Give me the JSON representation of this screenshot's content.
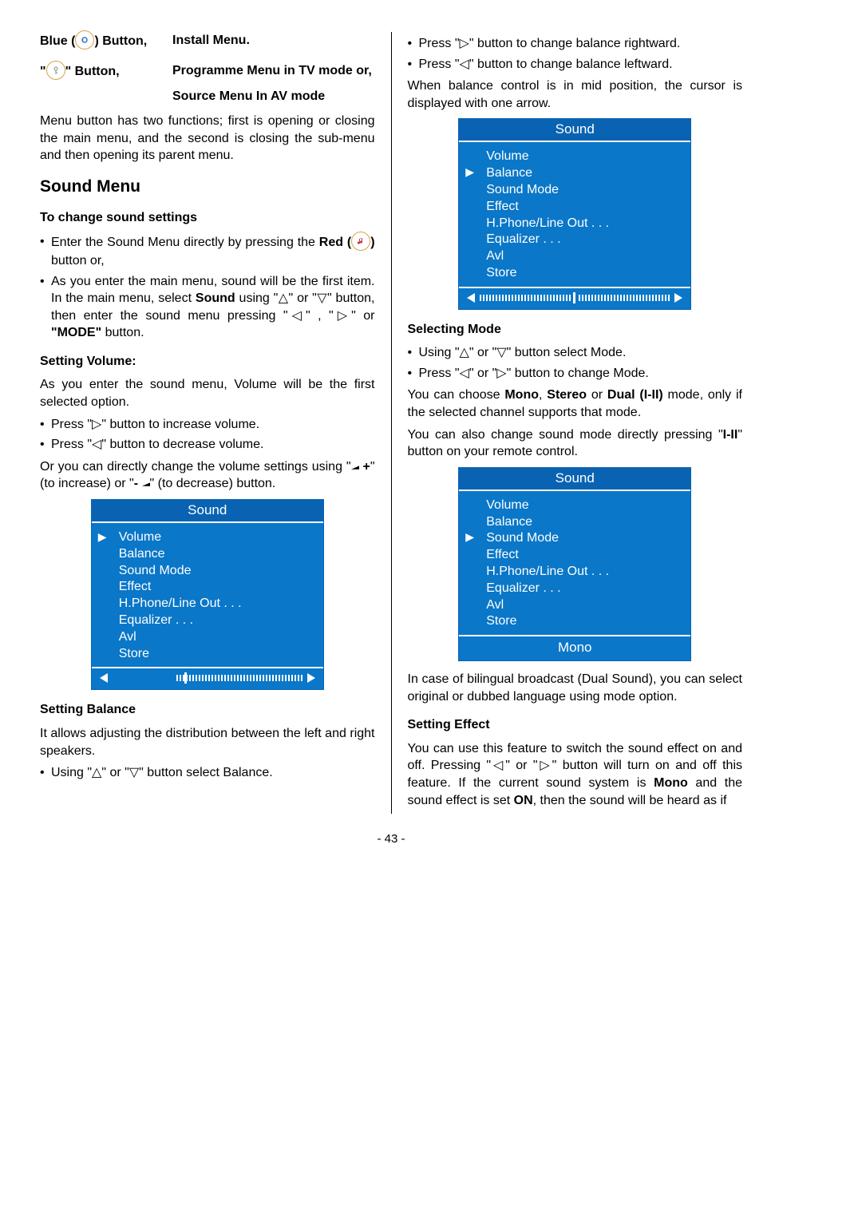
{
  "header": {
    "blue_label_a": "Blue (",
    "blue_label_b": ") Button,",
    "install_menu": "Install Menu.",
    "icon_button_a": "\"",
    "icon_button_b": "\" Button,",
    "programme_menu": "Programme Menu in TV mode or,",
    "source_menu": "Source Menu In AV mode"
  },
  "menu_button_desc": "Menu button has two functions; first is opening or closing the main menu, and the second is closing the sub-menu and then opening its parent menu.",
  "sound_menu_heading": "Sound Menu",
  "to_change_heading": "To change sound settings",
  "enter_sound_menu_a": "Enter the Sound Menu directly by pressing the ",
  "enter_sound_menu_b": "Red (",
  "enter_sound_menu_c": ")",
  "enter_sound_menu_d": " button or,",
  "main_menu_desc_a": "As you enter the main menu, sound will be the first item. In the main menu, select ",
  "main_menu_desc_b": "Sound",
  "main_menu_desc_c": " using \"△\" or \"▽\" button, then enter the sound menu pressing \"◁\" , \"▷\" or ",
  "main_menu_desc_d": "\"MODE\"",
  "main_menu_desc_e": " button.",
  "setting_volume_heading": "Setting Volume:",
  "setting_volume_intro": "As you enter the sound menu, Volume will be the first selected option.",
  "vol_inc": "Press \"▷\" button to increase volume.",
  "vol_dec": "Press \"◁\" button to decrease volume.",
  "vol_direct_a": "Or you can directly change the volume settings using \"",
  "vol_direct_b": " +",
  "vol_direct_c": "\" (to increase) or \"",
  "vol_direct_d": "- ",
  "vol_direct_e": "\" (to decrease) button.",
  "setting_balance_heading": "Setting Balance",
  "setting_balance_intro": "It allows adjusting the distribution between the left and right speakers.",
  "balance_select": "Using \"△\" or \"▽\" button select Balance.",
  "balance_right": "Press \"▷\" button to change balance rightward.",
  "balance_left": "Press \"◁\" button to change balance leftward.",
  "balance_mid": "When balance control is in mid position, the cursor is displayed with one arrow.",
  "selecting_mode_heading": "Selecting Mode",
  "mode_select": "Using \"△\" or \"▽\" button select Mode.",
  "mode_change": "Press \"◁\" or \"▷\" button to change Mode.",
  "mode_choose_a": "You can choose ",
  "mode_choose_b": "Mono",
  "mode_choose_c": ", ",
  "mode_choose_d": "Stereo",
  "mode_choose_e": " or ",
  "mode_choose_f": "Dual (I-II)",
  "mode_choose_g": " mode, only if the selected channel supports that mode.",
  "mode_direct_a": "You can also change sound mode directly pressing \"",
  "mode_direct_b": "I-II",
  "mode_direct_c": "\" button on your remote control.",
  "bilingual": "In case of bilingual broadcast (Dual Sound), you can select original or dubbed language using mode option.",
  "setting_effect_heading": "Setting Effect",
  "effect_desc_a": "You can use this feature to switch the sound effect on and off. Pressing \"◁\" or \"▷\" button will turn on and off this feature. If the current sound system is ",
  "effect_desc_b": "Mono",
  "effect_desc_c": " and the sound effect is set ",
  "effect_desc_d": "ON",
  "effect_desc_e": ", then the sound will be heard as if",
  "sound_panel": {
    "title": "Sound",
    "items": [
      "Volume",
      "Balance",
      "Sound Mode",
      "Effect",
      "H.Phone/Line Out . . .",
      "Equalizer . . .",
      "Avl",
      "Store"
    ],
    "mono_label": "Mono"
  },
  "page_num": "- 43 -"
}
